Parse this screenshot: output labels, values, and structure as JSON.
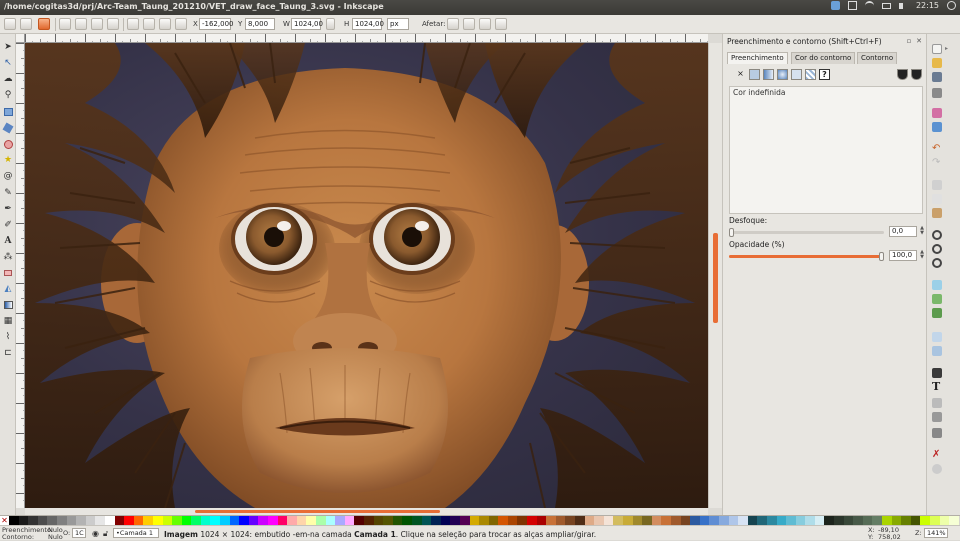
{
  "window": {
    "title": "/home/cogitas3d/prj/Arc-Team_Taung_201210/VET_draw_face_Taung_3.svg - Inkscape",
    "clock": "22:15"
  },
  "toolbar": {
    "x_label": "X",
    "x_value": "-162,000",
    "y_label": "Y",
    "y_value": "8,000",
    "w_label": "W",
    "w_value": "1024,00",
    "h_label": "H",
    "h_value": "1024,00",
    "unit": "px",
    "affect_label": "Afetar:"
  },
  "dock": {
    "title": "Preenchimento e contorno (Shift+Ctrl+F)",
    "tabs": [
      "Preenchimento",
      "Cor do contorno",
      "Contorno"
    ],
    "fill_state": "Cor indefinida",
    "blur_label": "Desfoque:",
    "blur_value": "0,0",
    "blur_level": 0,
    "opacity_label": "Opacidade (%)",
    "opacity_value": "100,0",
    "opacity_level": 1.0,
    "unknown_paint_symbol": "?",
    "no_paint_symbol": "×"
  },
  "statusbar": {
    "fill_label": "Preenchimento:",
    "fill_value": "Nulo",
    "stroke_label": "Contorno:",
    "stroke_value": "Nulo",
    "opacity_short": "O:",
    "opacity_value": "1C",
    "layer": "•Camada 1",
    "message_object": "Imagem",
    "message_rest": " 1024 × 1024: embutido -em-na camada ",
    "message_layer": "Camada 1",
    "message_tail": ". Clique na seleção para trocar as alças ampliar/girar.",
    "x_coord_label": "X:",
    "x_coord": "-89,10",
    "y_coord_label": "Y:",
    "y_coord": "758,02",
    "zoom_label": "Z:",
    "zoom": "141%"
  },
  "colors": {
    "accent": "#e86d35",
    "canvas_bg": "#353248",
    "skin": "#b8763f",
    "hair": "#4a2c14",
    "iris": "#8a5a2e"
  },
  "icons": {
    "tools": [
      "selector-icon",
      "node-icon",
      "tweak-icon",
      "zoom-icon",
      "rect-icon",
      "3dbox-icon",
      "ellipse-icon",
      "star-icon",
      "spiral-icon",
      "pencil-icon",
      "pen-icon",
      "calligraphy-icon",
      "text-icon",
      "spray-icon",
      "eraser-icon",
      "bucket-icon",
      "gradient-icon",
      "mesh-icon",
      "dropper-icon",
      "connector-icon"
    ]
  }
}
